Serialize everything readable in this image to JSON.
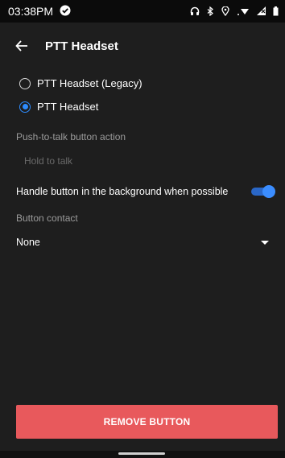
{
  "status": {
    "time": "03:38PM"
  },
  "toolbar": {
    "title": "PTT Headset"
  },
  "radio_options": [
    {
      "label": "PTT Headset (Legacy)",
      "selected": false
    },
    {
      "label": "PTT Headset",
      "selected": true
    }
  ],
  "settings": {
    "ptt_action_label": "Push-to-talk button action",
    "ptt_action_value": "Hold to talk",
    "background_label": "Handle button in the background when possible",
    "background_enabled": true,
    "button_contact_label": "Button contact",
    "button_contact_value": "None"
  },
  "actions": {
    "remove_label": "REMOVE BUTTON"
  },
  "colors": {
    "accent": "#2d8cff",
    "danger": "#e8595c",
    "background": "#1e1e1e"
  }
}
